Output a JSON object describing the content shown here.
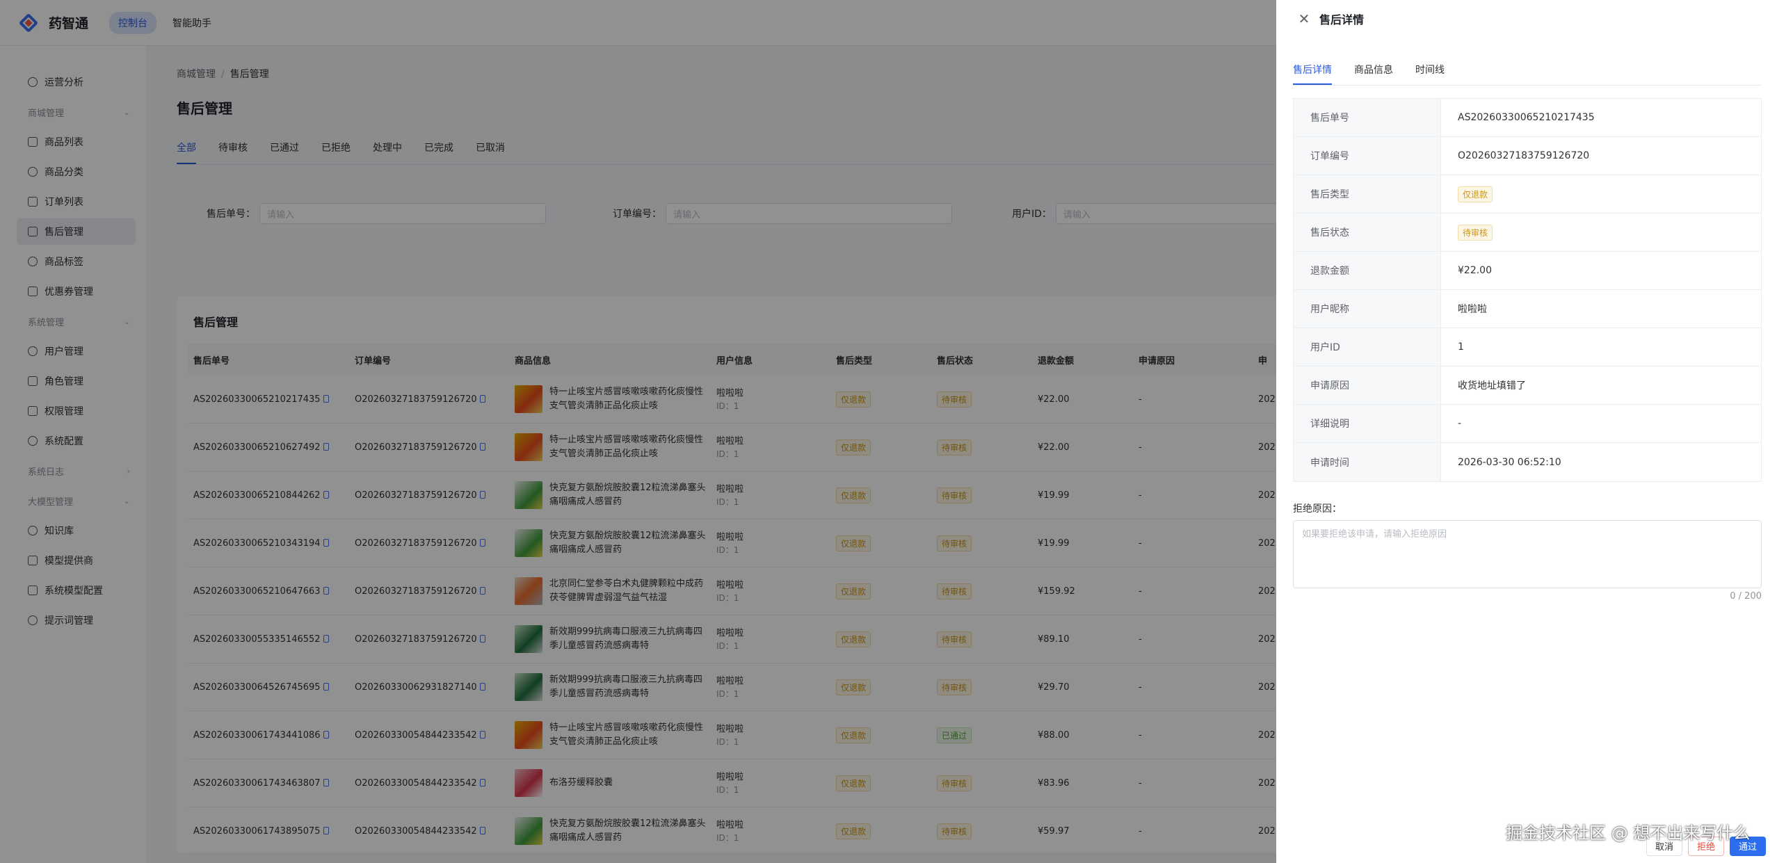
{
  "app": {
    "title": "药智通",
    "nav": [
      "控制台",
      "智能助手"
    ]
  },
  "sidebar": {
    "items": [
      {
        "type": "item",
        "label": "运营分析"
      },
      {
        "type": "group",
        "label": "商城管理"
      },
      {
        "type": "item",
        "label": "商品列表"
      },
      {
        "type": "item",
        "label": "商品分类"
      },
      {
        "type": "item",
        "label": "订单列表"
      },
      {
        "type": "item",
        "label": "售后管理",
        "active": true
      },
      {
        "type": "item",
        "label": "商品标签"
      },
      {
        "type": "item",
        "label": "优惠券管理"
      },
      {
        "type": "group",
        "label": "系统管理"
      },
      {
        "type": "item",
        "label": "用户管理"
      },
      {
        "type": "item",
        "label": "角色管理"
      },
      {
        "type": "item",
        "label": "权限管理"
      },
      {
        "type": "item",
        "label": "系统配置"
      },
      {
        "type": "group",
        "label": "系统日志",
        "collapsed": true
      },
      {
        "type": "group",
        "label": "大模型管理"
      },
      {
        "type": "item",
        "label": "知识库"
      },
      {
        "type": "item",
        "label": "模型提供商"
      },
      {
        "type": "item",
        "label": "系统模型配置"
      },
      {
        "type": "item",
        "label": "提示词管理"
      }
    ]
  },
  "breadcrumb": {
    "parent": "商城管理",
    "sep": "/",
    "current": "售后管理"
  },
  "page": {
    "title": "售后管理",
    "tabs": [
      "全部",
      "待审核",
      "已通过",
      "已拒绝",
      "处理中",
      "已完成",
      "已取消"
    ],
    "filters": [
      {
        "label": "售后单号：",
        "placeholder": "请输入"
      },
      {
        "label": "订单编号：",
        "placeholder": "请输入"
      },
      {
        "label": "用户ID：",
        "placeholder": "请输入"
      }
    ]
  },
  "table": {
    "title": "售后管理",
    "headers": [
      "售后单号",
      "订单编号",
      "商品信息",
      "用户信息",
      "售后类型",
      "售后状态",
      "退款金额",
      "申请原因",
      "申"
    ],
    "rows": [
      {
        "as_no": "AS20260330065210217435",
        "order_no": "O20260327183759126720",
        "product": "特一止咳宝片感冒咳嗽咳嗽药化痰慢性支气管炎清肺正品化痰止咳",
        "thumb": "red",
        "user": "啦啦啦",
        "uid": "ID：1",
        "type": "仅退款",
        "status": "待审核",
        "status_kind": "warn",
        "amount": "¥22.00",
        "reason": "-",
        "apply": "202"
      },
      {
        "as_no": "AS20260330065210627492",
        "order_no": "O20260327183759126720",
        "product": "特一止咳宝片感冒咳嗽咳嗽药化痰慢性支气管炎清肺正品化痰止咳",
        "thumb": "red",
        "user": "啦啦啦",
        "uid": "ID：1",
        "type": "仅退款",
        "status": "待审核",
        "status_kind": "warn",
        "amount": "¥22.00",
        "reason": "-",
        "apply": "202"
      },
      {
        "as_no": "AS20260330065210844262",
        "order_no": "O20260327183759126720",
        "product": "快克复方氨酚烷胺胶囊12粒流涕鼻塞头痛咽痛成人感冒药",
        "thumb": "green",
        "user": "啦啦啦",
        "uid": "ID：1",
        "type": "仅退款",
        "status": "待审核",
        "status_kind": "warn",
        "amount": "¥19.99",
        "reason": "-",
        "apply": "202"
      },
      {
        "as_no": "AS20260330065210343194",
        "order_no": "O20260327183759126720",
        "product": "快克复方氨酚烷胺胶囊12粒流涕鼻塞头痛咽痛成人感冒药",
        "thumb": "green",
        "user": "啦啦啦",
        "uid": "ID：1",
        "type": "仅退款",
        "status": "待审核",
        "status_kind": "warn",
        "amount": "¥19.99",
        "reason": "-",
        "apply": "202"
      },
      {
        "as_no": "AS20260330065210647663",
        "order_no": "O20260327183759126720",
        "product": "北京同仁堂参苓白术丸健脾颗粒中成药茯苓健脾胃虚弱湿气益气祛湿",
        "thumb": "mix",
        "user": "啦啦啦",
        "uid": "ID：1",
        "type": "仅退款",
        "status": "待审核",
        "status_kind": "warn",
        "amount": "¥159.92",
        "reason": "-",
        "apply": "202"
      },
      {
        "as_no": "AS20260330055335146552",
        "order_no": "O20260327183759126720",
        "product": "新效期999抗病毒口服液三九抗病毒四季儿童感冒药流感病毒特",
        "thumb": "dgreen",
        "user": "啦啦啦",
        "uid": "ID：1",
        "type": "仅退款",
        "status": "待审核",
        "status_kind": "warn",
        "amount": "¥89.10",
        "reason": "-",
        "apply": "202"
      },
      {
        "as_no": "AS20260330064526745695",
        "order_no": "O20260330062931827140",
        "product": "新效期999抗病毒口服液三九抗病毒四季儿童感冒药流感病毒特",
        "thumb": "dgreen",
        "user": "啦啦啦",
        "uid": "ID：1",
        "type": "仅退款",
        "status": "待审核",
        "status_kind": "warn",
        "amount": "¥29.70",
        "reason": "-",
        "apply": "202"
      },
      {
        "as_no": "AS20260330061743441086",
        "order_no": "O20260330054844233542",
        "product": "特一止咳宝片感冒咳嗽咳嗽药化痰慢性支气管炎清肺正品化痰止咳",
        "thumb": "red",
        "user": "啦啦啦",
        "uid": "ID：1",
        "type": "仅退款",
        "status": "已通过",
        "status_kind": "ok",
        "amount": "¥88.00",
        "reason": "-",
        "apply": "202"
      },
      {
        "as_no": "AS20260330061743463807",
        "order_no": "O20260330054844233542",
        "product": "布洛芬缓释胶囊",
        "thumb": "pink",
        "user": "啦啦啦",
        "uid": "ID：1",
        "type": "仅退款",
        "status": "待审核",
        "status_kind": "warn",
        "amount": "¥83.96",
        "reason": "-",
        "apply": "202"
      },
      {
        "as_no": "AS20260330061743895075",
        "order_no": "O20260330054844233542",
        "product": "快克复方氨酚烷胺胶囊12粒流涕鼻塞头痛咽痛成人感冒药",
        "thumb": "green",
        "user": "啦啦啦",
        "uid": "ID：1",
        "type": "仅退款",
        "status": "待审核",
        "status_kind": "warn",
        "amount": "¥59.97",
        "reason": "-",
        "apply": "202"
      }
    ]
  },
  "drawer": {
    "title": "售后详情",
    "tabs": [
      "售后详情",
      "商品信息",
      "时间线"
    ],
    "fields": [
      {
        "label": "售后单号",
        "value": "AS20260330065210217435"
      },
      {
        "label": "订单编号",
        "value": "O20260327183759126720"
      },
      {
        "label": "售后类型",
        "value": "仅退款",
        "tag": true
      },
      {
        "label": "售后状态",
        "value": "待审核",
        "tag": true
      },
      {
        "label": "退款金额",
        "value": "¥22.00"
      },
      {
        "label": "用户昵称",
        "value": "啦啦啦"
      },
      {
        "label": "用户ID",
        "value": "1"
      },
      {
        "label": "申请原因",
        "value": "收货地址填错了"
      },
      {
        "label": "详细说明",
        "value": "-"
      },
      {
        "label": "申请时间",
        "value": "2026-03-30 06:52:10"
      }
    ],
    "reject_label": "拒绝原因：",
    "reject_placeholder": "如果要拒绝该申请，请输入拒绝原因",
    "counter": "0 / 200",
    "buttons": {
      "cancel": "取消",
      "reject": "拒绝",
      "approve": "通过"
    }
  },
  "watermark": "掘金技术社区 @ 想不出来写什么"
}
